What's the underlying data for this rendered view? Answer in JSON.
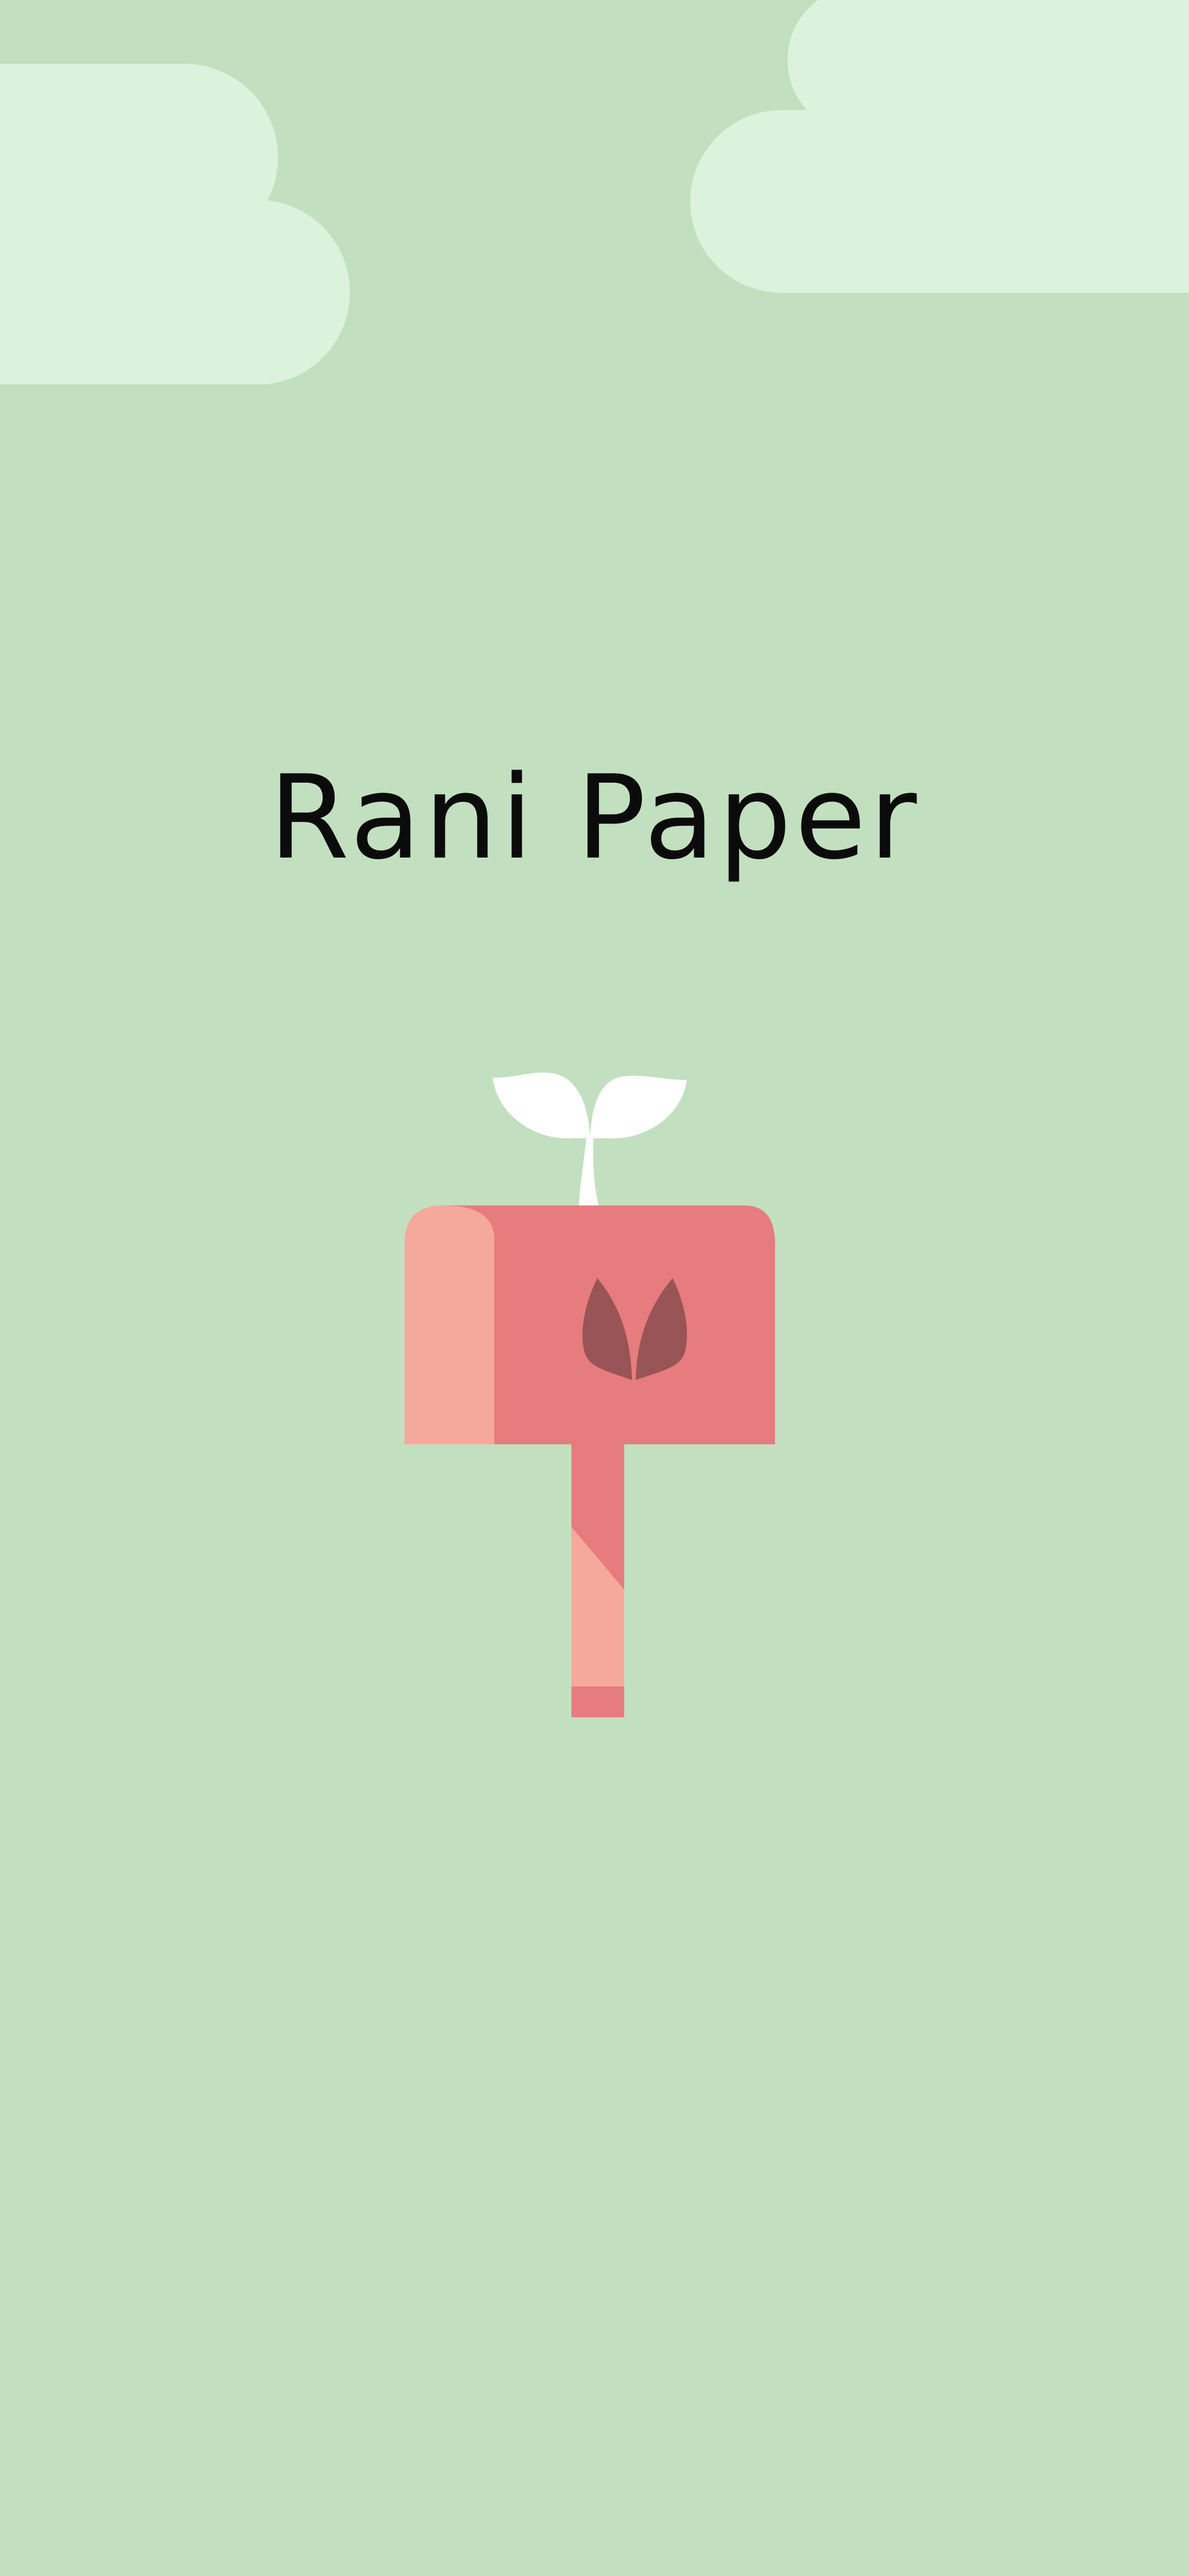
{
  "splash": {
    "app_name": "Rani Paper",
    "background_color": "#c2e0bf",
    "cloud_color": "#dcf2dc",
    "logo": {
      "icon": "seedling-mailbox-logo",
      "colors": {
        "primary": "#e67c7d",
        "light": "#f5a99b",
        "dark": "#985456",
        "sprout": "#ffffff"
      }
    },
    "decorations": [
      "cloud-icon",
      "cloud-icon"
    ]
  }
}
